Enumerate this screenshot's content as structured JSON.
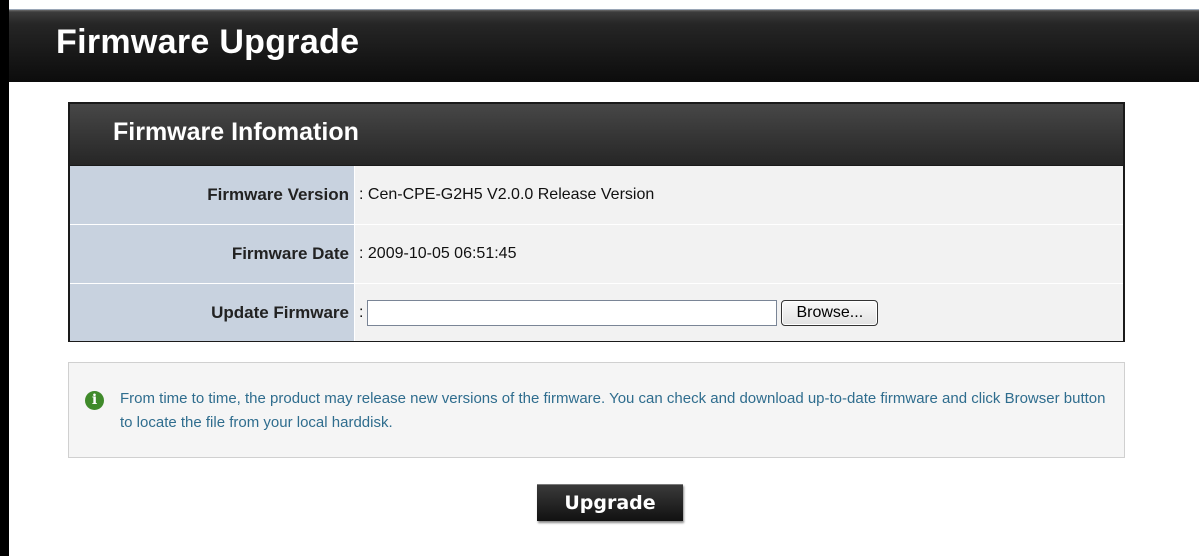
{
  "page": {
    "title": "Firmware Upgrade"
  },
  "panel": {
    "title": "Firmware Infomation",
    "rows": [
      {
        "label": "Firmware Version",
        "value": ": Cen-CPE-G2H5 V2.0.0 Release Version"
      },
      {
        "label": "Firmware Date",
        "value": ": 2009-10-05 06:51:45"
      },
      {
        "label": "Update Firmware",
        "separator": ":",
        "input_value": "",
        "browse_label": "Browse..."
      }
    ]
  },
  "help": {
    "icon": "info-icon",
    "text": "From time to time, the product may release new versions of the firmware. You can check and download up-to-date firmware and click Browser button to locate the file from your local harddisk."
  },
  "actions": {
    "upgrade_label": "Upgrade"
  }
}
